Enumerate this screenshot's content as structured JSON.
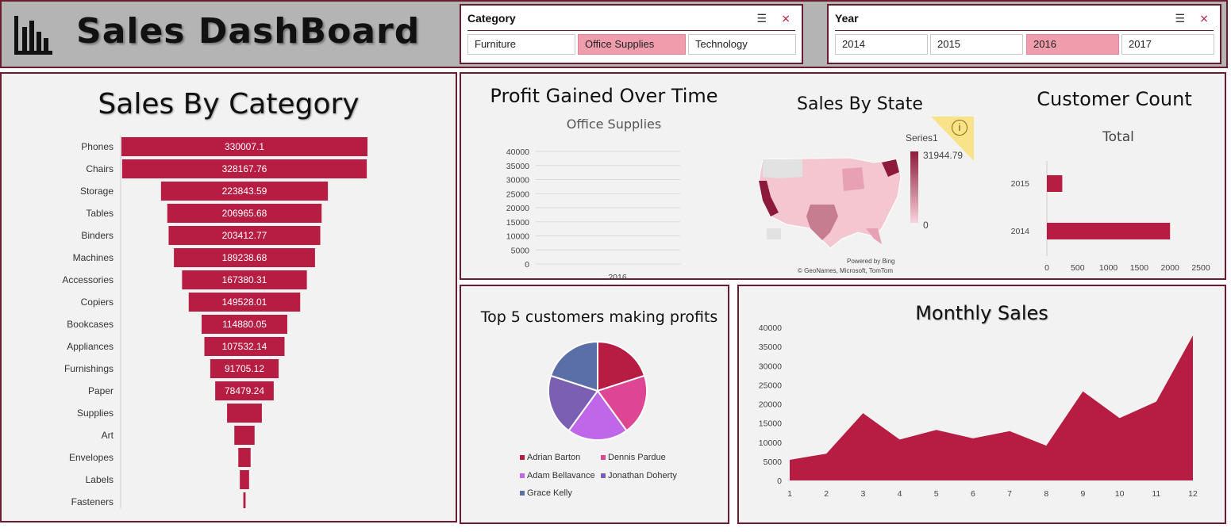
{
  "header": {
    "title": "Sales DashBoard",
    "icon": "bar-chart-icon"
  },
  "slicers": {
    "category": {
      "label": "Category",
      "options": [
        "Furniture",
        "Office Supplies",
        "Technology"
      ],
      "selected": "Office Supplies"
    },
    "year": {
      "label": "Year",
      "options": [
        "2014",
        "2015",
        "2016",
        "2017"
      ],
      "selected": "2016"
    }
  },
  "sales_by_category": {
    "title": "Sales By Category"
  },
  "profit_over_time": {
    "title": "Profit Gained Over Time",
    "subtitle": "Office Supplies"
  },
  "sales_by_state": {
    "title": "Sales By State",
    "legend_title": "Series1",
    "legend_max": "31944.79",
    "legend_min": "0",
    "credit_1": "Powered by Bing",
    "credit_2": "© GeoNames, Microsoft, TomTom"
  },
  "customer_count": {
    "title": "Customer Count",
    "subtitle": "Total"
  },
  "top_customers": {
    "title": "Top 5 customers making profits"
  },
  "monthly_sales": {
    "title": "Monthly Sales"
  },
  "colors": {
    "accent": "#b71c42",
    "border": "#6b1d2f",
    "selected": "#ef9cac"
  },
  "chart_data": [
    {
      "type": "bar",
      "title": "Sales By Category",
      "orientation": "horizontal-funnel",
      "categories": [
        "Phones",
        "Chairs",
        "Storage",
        "Tables",
        "Binders",
        "Machines",
        "Accessories",
        "Copiers",
        "Bookcases",
        "Appliances",
        "Furnishings",
        "Paper",
        "Supplies",
        "Art",
        "Envelopes",
        "Labels",
        "Fasteners"
      ],
      "values": [
        330007.1,
        328167.76,
        223843.59,
        206965.68,
        203412.77,
        189238.68,
        167380.31,
        149528.01,
        114880.05,
        107532.14,
        91705.12,
        78479.24,
        46673.54,
        27118.79,
        16476.4,
        12486.31,
        3024.28
      ],
      "data_labels": [
        "330007.1",
        "328167.76",
        "223843.59",
        "206965.68",
        "203412.77",
        "189238.68",
        "167380.31",
        "149528.01",
        "114880.05",
        "107532.14",
        "91705.12",
        "78479.24",
        "",
        "",
        "",
        "",
        ""
      ],
      "color": "#b71c42"
    },
    {
      "type": "line",
      "title": "Office Supplies",
      "categories": [
        "2016"
      ],
      "values": [],
      "ylim": [
        0,
        40000
      ],
      "yticks": [
        "0",
        "5000",
        "10000",
        "15000",
        "20000",
        "25000",
        "30000",
        "35000",
        "40000"
      ],
      "grid": true
    },
    {
      "type": "bar",
      "title": "Total",
      "orientation": "horizontal",
      "categories": [
        "2015",
        "2014"
      ],
      "values": [
        250,
        2000
      ],
      "xlim": [
        0,
        2500
      ],
      "xticks": [
        "0",
        "500",
        "1000",
        "1500",
        "2000",
        "2500"
      ],
      "color": "#b71c42"
    },
    {
      "type": "pie",
      "title": "Top 5 customers making profits",
      "labels": [
        "Adrian Barton",
        "Dennis Pardue",
        "Adam Bellavance",
        "Jonathan Doherty",
        "Grace Kelly"
      ],
      "values": [
        20,
        20,
        20,
        20,
        20
      ],
      "colors": [
        "#b71c42",
        "#de4592",
        "#c066e8",
        "#7b5fb3",
        "#5a6ea8"
      ],
      "legend": "bottom"
    },
    {
      "type": "area",
      "title": "Monthly Sales",
      "x": [
        "1",
        "2",
        "3",
        "4",
        "5",
        "6",
        "7",
        "8",
        "9",
        "10",
        "11",
        "12"
      ],
      "values": [
        5400,
        7000,
        17600,
        10700,
        13200,
        11000,
        12900,
        9100,
        23300,
        16300,
        20600,
        37900
      ],
      "ylim": [
        0,
        40000
      ],
      "yticks": [
        "0",
        "5000",
        "10000",
        "15000",
        "20000",
        "25000",
        "30000",
        "35000",
        "40000"
      ],
      "color": "#b71c42"
    }
  ]
}
